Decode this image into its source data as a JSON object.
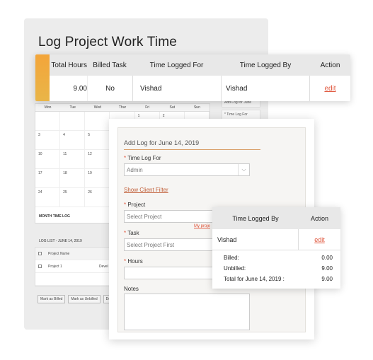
{
  "page_title": "Log Project Work Time",
  "top_table": {
    "headers": [
      "Total Hours",
      "Billed Task",
      "Time Logged For",
      "Time Logged By",
      "Action"
    ],
    "row": {
      "total_hours": "9.00",
      "billed_task": "No",
      "logged_for": "Vishad",
      "logged_by": "Vishad",
      "action": "edit"
    }
  },
  "calendar": {
    "weekdays": [
      "Mon",
      "Tue",
      "Wed",
      "Thur",
      "Fri",
      "Sat",
      "Sun"
    ],
    "weeks": [
      [
        "",
        "",
        "",
        "",
        "1",
        "2",
        ""
      ],
      [
        "3",
        "4",
        "5",
        "",
        "",
        "",
        ""
      ],
      [
        "10",
        "11",
        "12",
        "",
        "",
        "",
        ""
      ],
      [
        "17",
        "18",
        "19",
        "",
        "",
        "",
        ""
      ],
      [
        "24",
        "25",
        "26",
        "27",
        "",
        "",
        ""
      ]
    ],
    "title": "MONTH TIME LOG"
  },
  "side_menu": [
    "Add Log for June",
    "* Time Log For"
  ],
  "log_list": {
    "title": "LOG LIST - JUNE 14, 2019",
    "header": [
      "Project Name",
      "Devel"
    ],
    "rows": [
      [
        "Project 1",
        "Devel"
      ]
    ],
    "buttons": [
      "Mark as Billed",
      "Mark as Unbilled",
      "Del"
    ]
  },
  "add_log": {
    "title": "Add Log for June 14, 2019",
    "time_log_for_label": "Time Log For",
    "time_log_for_value": "Admin",
    "show_client_filter": "Show Client Filter",
    "project_label": "Project",
    "project_placeholder": "Select Project",
    "my_projects_link": "My proje",
    "task_label": "Task",
    "task_placeholder": "Select Project First",
    "hours_label": "Hours",
    "notes_label": "Notes",
    "required_mark": "*"
  },
  "summary": {
    "headers": [
      "Time Logged By",
      "Action"
    ],
    "row": {
      "logged_by": "Vishad",
      "action": "edit"
    },
    "totals": [
      {
        "label": "Billed:",
        "value": "0.00"
      },
      {
        "label": "Unbilled:",
        "value": "9.00"
      },
      {
        "label": "Total for June 14, 2019 :",
        "value": "9.00"
      }
    ]
  },
  "colors": {
    "accent": "#f3a53a",
    "link": "#e0563c"
  }
}
